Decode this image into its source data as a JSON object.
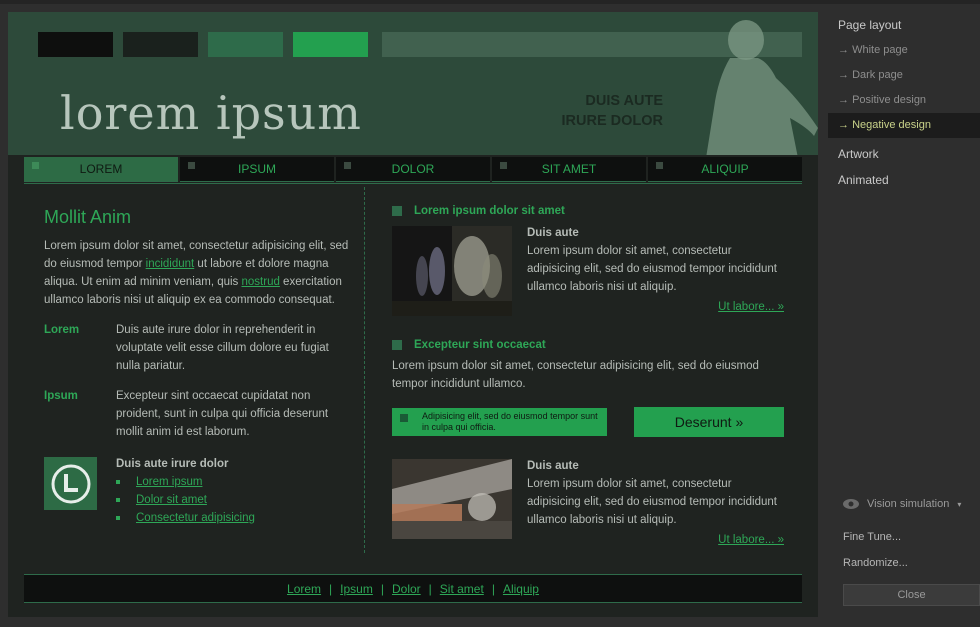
{
  "banner": {
    "site_title": "lorem ipsum",
    "tagline_line1": "DUIS AUTE",
    "tagline_line2": "IRURE DOLOR"
  },
  "nav": {
    "items": [
      "LOREM",
      "IPSUM",
      "DOLOR",
      "SIT AMET",
      "ALIQUIP"
    ],
    "active": "LOREM"
  },
  "left": {
    "heading": "Mollit Anim",
    "intro_part1": "Lorem ipsum dolor sit amet, consectetur adipisicing elit, sed do eiusmod tempor ",
    "intro_link1": "incididunt",
    "intro_part2": " ut labore et dolore magna aliqua. Ut enim ad minim veniam, quis ",
    "intro_link2": "nostrud",
    "intro_part3": " exercitation ullamco laboris nisi ut aliquip ex ea commodo consequat.",
    "definitions": [
      {
        "term": "Lorem",
        "text": "Duis aute irure dolor in reprehenderit in voluptate velit esse cillum dolore eu fugiat nulla pariatur."
      },
      {
        "term": "Ipsum",
        "text": "Excepteur sint occaecat cupidatat non proident, sunt in culpa qui officia deserunt mollit anim id est laborum."
      }
    ],
    "box_title": "Duis aute irure dolor",
    "box_links": [
      "Lorem ipsum",
      "Dolor sit amet",
      "Consectetur adipisicing"
    ]
  },
  "right": {
    "section1_heading": "Lorem ipsum dolor sit amet",
    "item1_title": "Duis aute",
    "item1_text": "Lorem ipsum dolor sit amet, consectetur adipisicing elit, sed do eiusmod tempor incididunt ullamco laboris nisi ut aliquip.",
    "item1_more": "Ut labore... »",
    "section2_heading": "Excepteur sint occaecat",
    "section2_text": "Lorem ipsum dolor sit amet, consectetur adipisicing elit, sed do eiusmod tempor incididunt ullamco.",
    "promo_text": "Adipisicing elit, sed do eiusmod tempor sunt in culpa qui officia.",
    "cta_label": "Deserunt »",
    "item2_title": "Duis aute",
    "item2_text": "Lorem ipsum dolor sit amet, consectetur adipisicing elit, sed do eiusmod tempor incididunt ullamco laboris nisi ut aliquip.",
    "item2_more": "Ut labore... »"
  },
  "footer": {
    "links": [
      "Lorem",
      "Ipsum",
      "Dolor",
      "Sit amet",
      "Aliquip"
    ]
  },
  "panel": {
    "page_layout": "Page layout",
    "layouts": [
      "White page",
      "Dark page",
      "Positive design",
      "Negative design"
    ],
    "active_layout": "Negative design",
    "artwork": "Artwork",
    "animated": "Animated",
    "vision_label": "Vision simulation",
    "fine_tune": "Fine Tune...",
    "randomize": "Randomize...",
    "close": "Close"
  },
  "colors": {
    "accent": "#23a04f",
    "accent_dark": "#2d6b45",
    "banner_bg": "#2d4a3a",
    "page_bg": "#1f2320",
    "active_layout_text": "#c9d28a"
  }
}
